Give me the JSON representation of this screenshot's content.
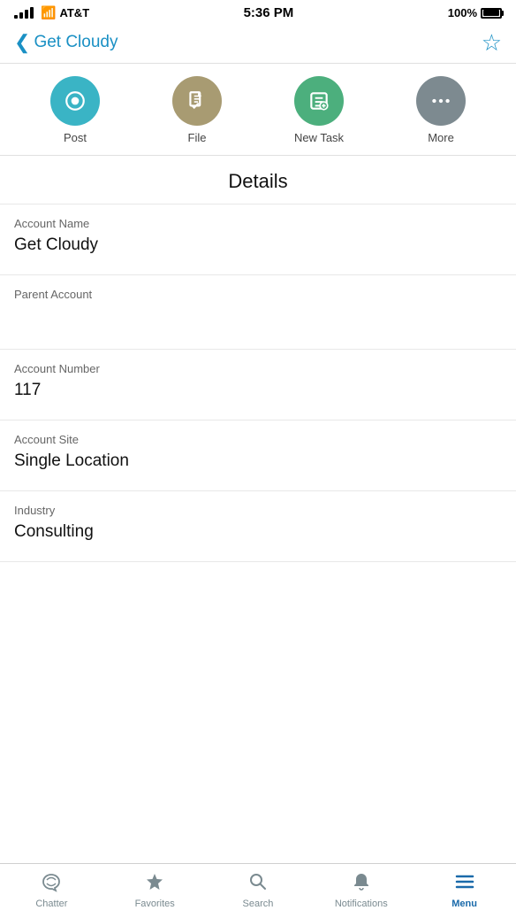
{
  "statusBar": {
    "carrier": "AT&T",
    "time": "5:36 PM",
    "battery": "100%"
  },
  "navBar": {
    "backLabel": "Get Cloudy",
    "starLabel": "☆"
  },
  "actionRow": {
    "items": [
      {
        "id": "post",
        "label": "Post",
        "colorClass": "circle-teal"
      },
      {
        "id": "file",
        "label": "File",
        "colorClass": "circle-sand"
      },
      {
        "id": "new-task",
        "label": "New Task",
        "colorClass": "circle-green"
      },
      {
        "id": "more",
        "label": "More",
        "colorClass": "circle-gray"
      }
    ]
  },
  "detailsSection": {
    "title": "Details"
  },
  "fields": [
    {
      "id": "account-name",
      "label": "Account Name",
      "value": "Get Cloudy"
    },
    {
      "id": "parent-account",
      "label": "Parent Account",
      "value": ""
    },
    {
      "id": "account-number",
      "label": "Account Number",
      "value": "117"
    },
    {
      "id": "account-site",
      "label": "Account Site",
      "value": "Single Location"
    },
    {
      "id": "industry",
      "label": "Industry",
      "value": "Consulting"
    }
  ],
  "bottomNav": {
    "items": [
      {
        "id": "chatter",
        "label": "Chatter",
        "active": false
      },
      {
        "id": "favorites",
        "label": "Favorites",
        "active": false
      },
      {
        "id": "search",
        "label": "Search",
        "active": false
      },
      {
        "id": "notifications",
        "label": "Notifications",
        "active": false
      },
      {
        "id": "menu",
        "label": "Menu",
        "active": true
      }
    ]
  }
}
